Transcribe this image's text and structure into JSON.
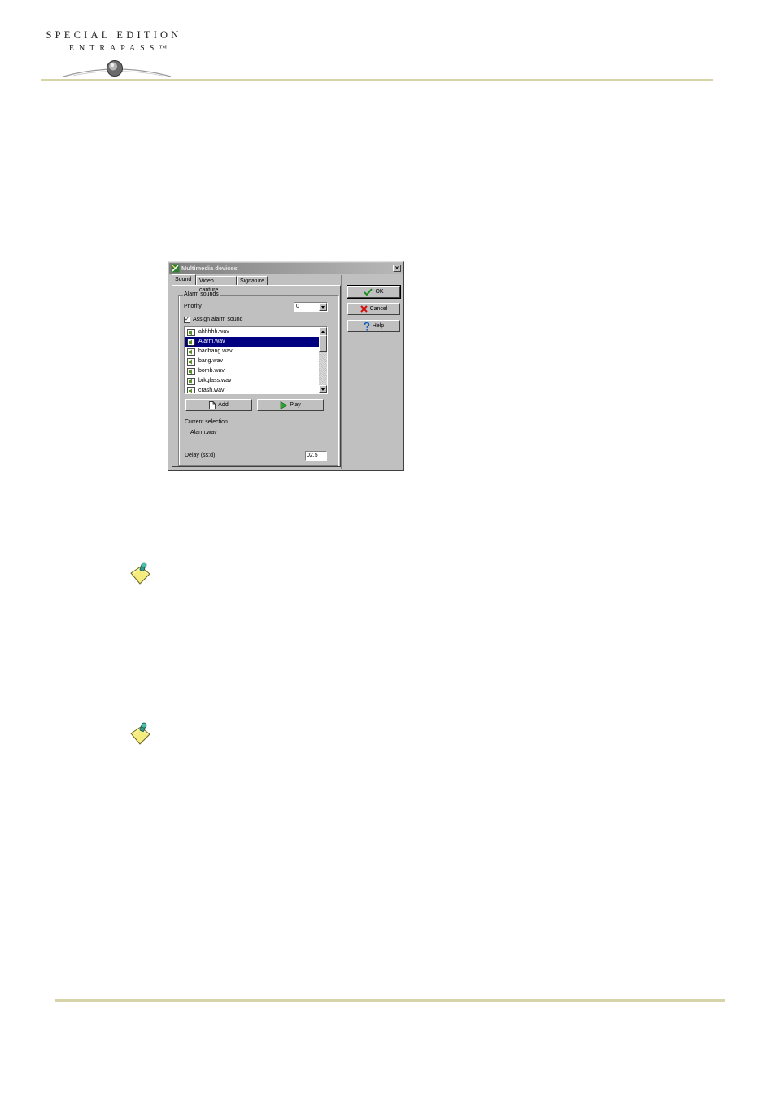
{
  "header": {
    "logo_line1": "SPECIAL EDITION",
    "logo_line2": "ENTRAPASS™"
  },
  "dialog": {
    "title": "Multimedia devices",
    "close_glyph": "×",
    "tabs": [
      {
        "label": "Sound",
        "active": true
      },
      {
        "label": "Video capture",
        "active": false
      },
      {
        "label": "Signature",
        "active": false
      }
    ],
    "group_label": "Alarm sounds",
    "priority_label": "Priority",
    "priority_value": "0",
    "assign_label": "Assign alarm sound",
    "assign_checked": "✓",
    "sounds": [
      {
        "name": "ahhhhh.wav",
        "selected": false
      },
      {
        "name": "Alarm.wav",
        "selected": true
      },
      {
        "name": "badbang.wav",
        "selected": false
      },
      {
        "name": "bang.wav",
        "selected": false
      },
      {
        "name": "bomb.wav",
        "selected": false
      },
      {
        "name": "brkglass.wav",
        "selected": false
      },
      {
        "name": "crash.wav",
        "selected": false
      }
    ],
    "add_label": "Add",
    "play_label": "Play",
    "current_selection_label": "Current selection",
    "current_selection_value": "Alarm.wav",
    "delay_label": "Delay (ss:d)",
    "delay_value": "02.5",
    "ok_label": "OK",
    "cancel_label": "Cancel",
    "help_label": "Help"
  },
  "colors": {
    "rule": "#d6d4a8",
    "selection": "#000080",
    "dialog_face": "#c0c0c0"
  }
}
